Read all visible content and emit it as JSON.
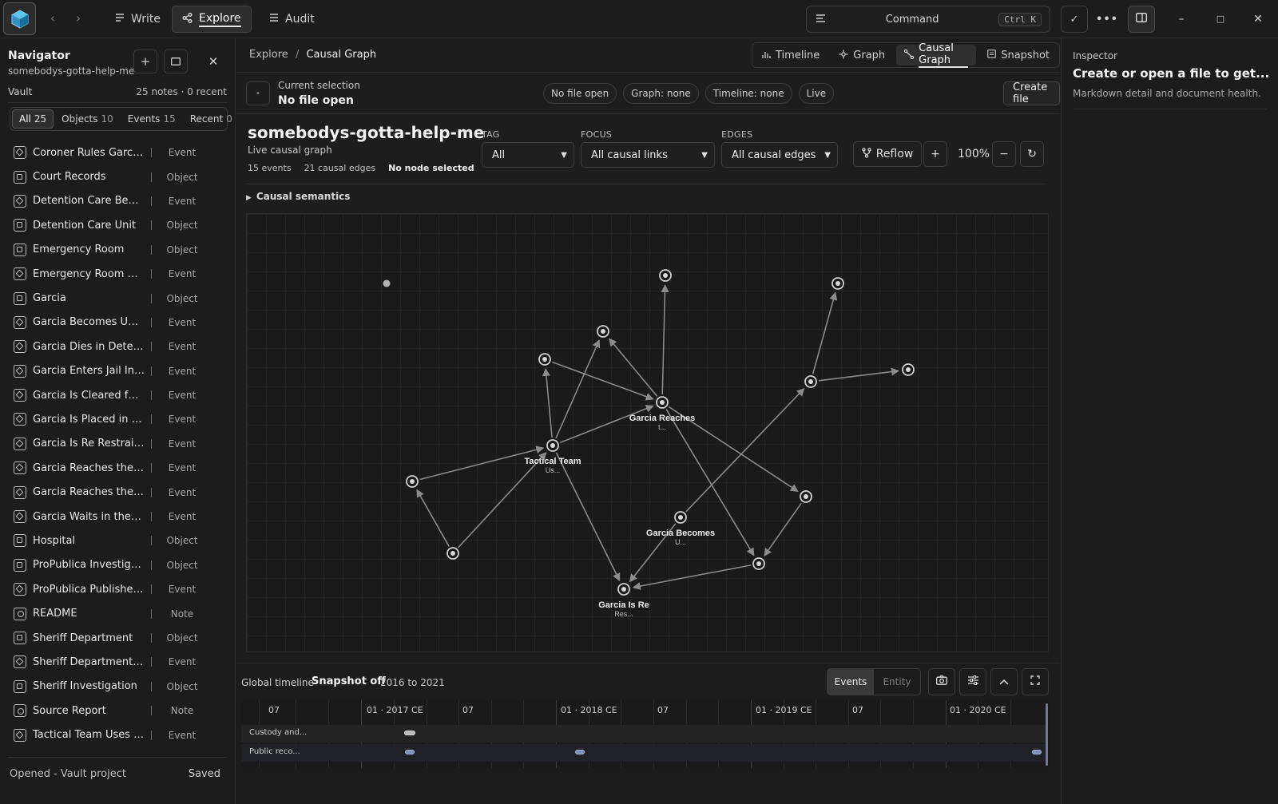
{
  "topbar": {
    "modes": [
      {
        "label": "Write",
        "icon": "lines-icon"
      },
      {
        "label": "Explore",
        "icon": "share-icon",
        "active": true
      },
      {
        "label": "Audit",
        "icon": "list-icon"
      }
    ],
    "command": {
      "label": "Command",
      "shortcut": "Ctrl K"
    }
  },
  "sidebar": {
    "title": "Navigator",
    "subtitle": "somebodys-gotta-help-me",
    "vault_label": "Vault",
    "vault_counts": "25 notes · 0 recent",
    "tabs": [
      {
        "label": "All",
        "count": "25",
        "active": true
      },
      {
        "label": "Objects",
        "count": "10"
      },
      {
        "label": "Events",
        "count": "15"
      },
      {
        "label": "Recent",
        "count": "0"
      }
    ],
    "files": [
      {
        "name": "Coroner Rules Garcias...",
        "type": "Event"
      },
      {
        "name": "Court Records",
        "type": "Object"
      },
      {
        "name": "Detention Care Bed O...",
        "type": "Event"
      },
      {
        "name": "Detention Care Unit",
        "type": "Object"
      },
      {
        "name": "Emergency Room",
        "type": "Object"
      },
      {
        "name": "Emergency Room Dia...",
        "type": "Event"
      },
      {
        "name": "Garcia",
        "type": "Object"
      },
      {
        "name": "Garcia Becomes Unre...",
        "type": "Event"
      },
      {
        "name": "Garcia Dies in Detenti...",
        "type": "Event"
      },
      {
        "name": "Garcia Enters Jail Intake",
        "type": "Event"
      },
      {
        "name": "Garcia Is Cleared for ...",
        "type": "Event"
      },
      {
        "name": "Garcia Is Placed in Iso...",
        "type": "Event"
      },
      {
        "name": "Garcia Is Re Restraine...",
        "type": "Event"
      },
      {
        "name": "Garcia Reaches the D...",
        "type": "Event"
      },
      {
        "name": "Garcia Reaches the E...",
        "type": "Event"
      },
      {
        "name": "Garcia Waits in the E...",
        "type": "Event"
      },
      {
        "name": "Hospital",
        "type": "Object"
      },
      {
        "name": "ProPublica Investigati...",
        "type": "Object"
      },
      {
        "name": "ProPublica Publishes ...",
        "type": "Event"
      },
      {
        "name": "README",
        "type": "Note"
      },
      {
        "name": "Sheriff Department",
        "type": "Object"
      },
      {
        "name": "Sheriff Department A...",
        "type": "Event"
      },
      {
        "name": "Sheriff Investigation",
        "type": "Object"
      },
      {
        "name": "Source Report",
        "type": "Note"
      },
      {
        "name": "Tactical Team Uses Fo...",
        "type": "Event"
      }
    ],
    "footer_status": "Opened - Vault project",
    "footer_saved": "Saved"
  },
  "main": {
    "breadcrumb_root": "Explore",
    "breadcrumb_sep": "/",
    "breadcrumb_current": "Causal Graph",
    "view_tabs": [
      {
        "label": "Timeline",
        "icon": "bar-chart-icon"
      },
      {
        "label": "Graph",
        "icon": "graph-icon"
      },
      {
        "label": "Causal Graph",
        "icon": "causal-icon",
        "active": true
      },
      {
        "label": "Snapshot",
        "icon": "snapshot-icon"
      }
    ],
    "selection_label": "Current selection",
    "selection_value": "No file open",
    "pills": [
      "No file open",
      "Graph: none",
      "Timeline: none",
      "Live"
    ],
    "create_button": "Create file",
    "graph_title": "somebodys-gotta-help-me",
    "graph_subtitle": "Live causal graph",
    "stats": {
      "events": "15 events",
      "edges": "21 causal edges",
      "selected": "No node selected"
    },
    "controls": {
      "tag_label": "TAG",
      "tag_value": "All",
      "focus_label": "FOCUS",
      "focus_value": "All causal links",
      "edges_label": "EDGES",
      "edges_value": "All causal edges",
      "reflow_label": "Reflow",
      "zoom": "100%"
    },
    "semantics_label": "Causal semantics"
  },
  "graph": {
    "node_labels": [
      {
        "title": "Garcia Reaches",
        "sub": "t..."
      },
      {
        "title": "Tactical Team",
        "sub": "Us..."
      },
      {
        "title": "Garcia Becomes",
        "sub": "U..."
      },
      {
        "title": "Garcia Is Re",
        "sub": "Res..."
      }
    ]
  },
  "timeline": {
    "label": "Global timeline",
    "snapshot": "Snapshot off",
    "range": "2016 to 2021",
    "toggle": [
      "Events",
      "Entity"
    ],
    "ticks": [
      "07",
      "01 · 2017 CE",
      "07",
      "01 · 2018 CE",
      "07",
      "01 · 2019 CE",
      "07",
      "01 · 2020 CE"
    ],
    "rows": [
      "Custody and...",
      "Public reco..."
    ]
  },
  "inspector": {
    "label": "Inspector",
    "title": "Create or open a file to get...",
    "description": "Markdown detail and document health."
  },
  "colors": {
    "accent_node": "#d8d8d8",
    "edge": "#8a8a8a",
    "timeline_bar": "#7d8fb8"
  }
}
